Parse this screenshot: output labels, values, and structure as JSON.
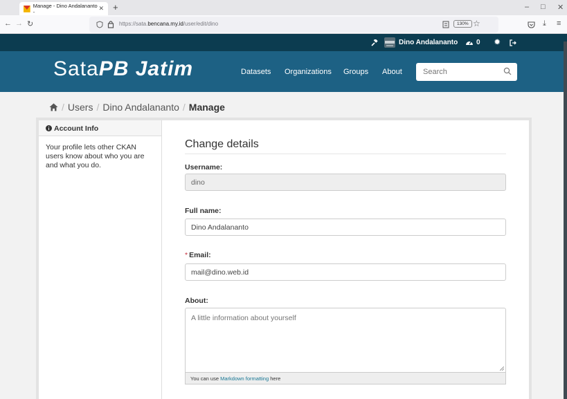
{
  "browser": {
    "tab_title": "Manage - Dino Andalananto - ",
    "url_prefix": "https://sata.",
    "url_domain": "bencana.my.id",
    "url_path": "/user/edit/dino",
    "zoom": "130%"
  },
  "account_bar": {
    "username": "Dino Andalananto",
    "dashboard_count": "0"
  },
  "site": {
    "logo_plain": "Sata",
    "logo_italic": "PB Jatim",
    "nav": [
      "Datasets",
      "Organizations",
      "Groups",
      "About"
    ],
    "search_placeholder": "Search"
  },
  "breadcrumb": {
    "items": [
      "Users",
      "Dino Andalananto"
    ],
    "active": "Manage"
  },
  "sidebar": {
    "heading": "Account Info",
    "text": "Your profile lets other CKAN users know about who you are and what you do."
  },
  "form": {
    "title": "Change details",
    "username_label": "Username:",
    "username_value": "dino",
    "fullname_label": "Full name:",
    "fullname_value": "Dino Andalananto",
    "email_required_mark": "*",
    "email_label": "Email:",
    "email_value": "mail@dino.web.id",
    "about_label": "About:",
    "about_placeholder": "A little information about yourself",
    "help_prefix": "You can use",
    "help_link": "Markdown formatting",
    "help_suffix": "here"
  },
  "colors": {
    "account_bar": "#0c3c50",
    "masthead": "#1d6184",
    "link": "#187794",
    "required": "#c6303e"
  }
}
